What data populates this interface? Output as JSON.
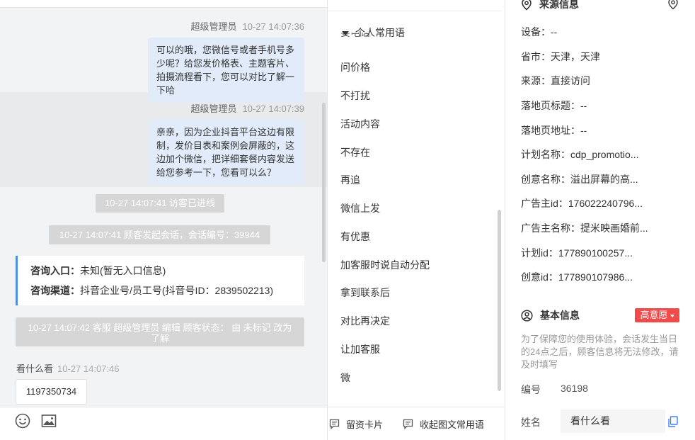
{
  "chat": {
    "messages": [
      {
        "sender": "超级管理员",
        "time": "10-27 14:07:36",
        "text": "可以的哦，您微信号或者手机号多少呢？给您发价格表、主题客片、拍摄流程看下，您可以对比了解一下哈"
      },
      {
        "sender": "超级管理员",
        "time": "10-27 14:07:39",
        "text": "亲亲，因为企业抖音平台这边有限制，发价目表和案例会屏蔽的，这边加个微信，把详细套餐内容发送给您参考一下，您看可以么？"
      }
    ],
    "system_messages": [
      "10-27 14:07:41 访客已进线",
      "10-27 14:07:41 顾客发起会话，会话编号：39944",
      "10-27 14:07:42 客服 超级管理员 编辑 顾客状态： 由 未标记 改为 了解"
    ],
    "info_card": {
      "entry_label": "咨询入口：",
      "entry_value": "未知(暂无入口信息)",
      "channel_label": "咨询渠道：",
      "channel_value": "抖音企业号/员工号(抖音号ID：2839502213)"
    },
    "visitor": {
      "name": "看什么看",
      "time": "10-27 14:07:46",
      "text": "1197350734"
    }
  },
  "phrases": {
    "header": "个人常用语",
    "partial_top": "要电话",
    "items": [
      "问价格",
      "不打扰",
      "活动内容",
      "不存在",
      "再追",
      "微信上发",
      "有优惠",
      "加客服时说自动分配",
      "拿到联系后",
      "对比再决定",
      "让加客服",
      "微"
    ],
    "footer": {
      "card_button": "留资卡片",
      "collapse_button": "收起图文常用语"
    }
  },
  "info": {
    "source_title": "来源信息",
    "source_rows": [
      "设备：--",
      "省市：天津，天津",
      "来源：直接访问",
      "落地页标题：--",
      "落地页地址：--",
      "计划名称：cdp_promotio...",
      "创意名称：溢出屏幕的高...",
      "广告主id：176022240796...",
      "广告主名称：提米映画婚前...",
      "计划id：177890100257...",
      "创意id：177890107986..."
    ],
    "basic_title": "基本信息",
    "intent_badge": "高意愿",
    "notice": "为了保障您的使用体验，会话发生当日的24点之后，顾客信息将无法修改，请及时填写",
    "id_label": "编号",
    "id_value": "36198",
    "name_label": "姓名",
    "name_value": "看什么看"
  },
  "colors": {
    "accent": "#4a90e2",
    "badge": "#f04a4a",
    "bubble_out": "#e1ebfa"
  }
}
